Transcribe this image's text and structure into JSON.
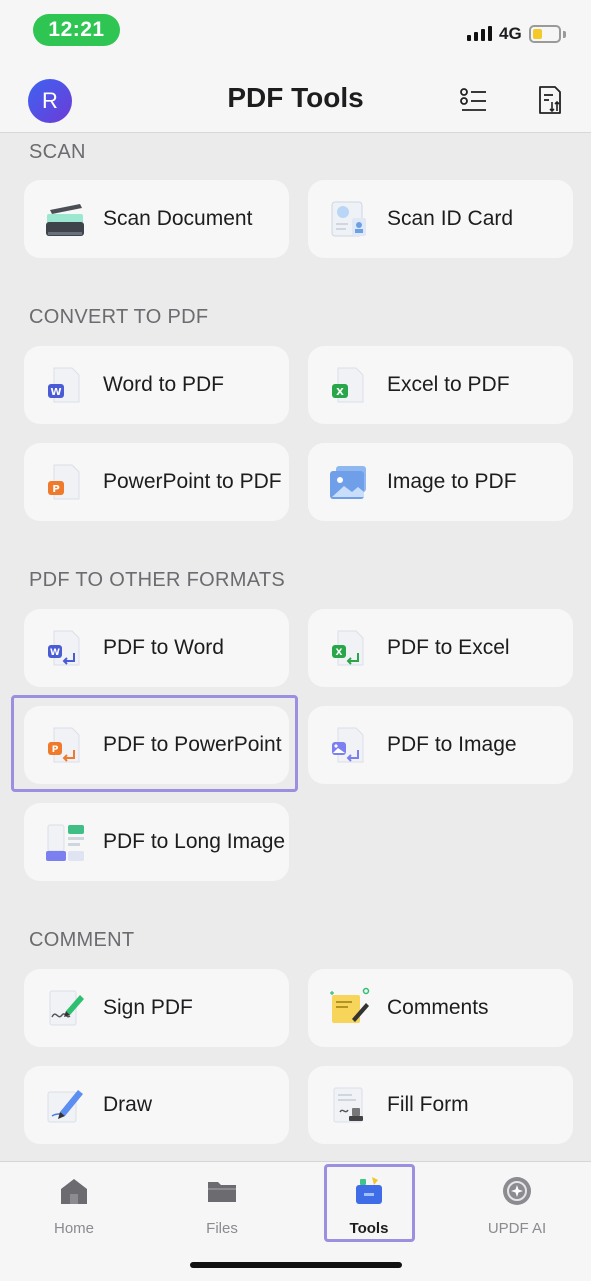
{
  "status": {
    "time": "12:21",
    "network": "4G"
  },
  "header": {
    "avatar_letter": "R",
    "title": "PDF Tools"
  },
  "sections": {
    "scan": {
      "title": "SCAN",
      "items": [
        "Scan Document",
        "Scan ID Card"
      ]
    },
    "convert_to_pdf": {
      "title": "CONVERT TO PDF",
      "items": [
        "Word to PDF",
        "Excel to PDF",
        "PowerPoint to PDF",
        "Image to PDF"
      ]
    },
    "pdf_to_other": {
      "title": "PDF TO OTHER FORMATS",
      "items": [
        "PDF to Word",
        "PDF to Excel",
        "PDF to PowerPoint",
        "PDF to Image",
        "PDF to Long Image"
      ]
    },
    "comment": {
      "title": "COMMENT",
      "items": [
        "Sign PDF",
        "Comments",
        "Draw",
        "Fill Form"
      ]
    }
  },
  "tabs": [
    "Home",
    "Files",
    "Tools",
    "UPDF AI"
  ],
  "colors": {
    "accent": "#9b8fe0",
    "status_green": "#2fc553",
    "word": "#4a5bd6",
    "excel": "#2aa64a",
    "ppt": "#f07a2c"
  }
}
